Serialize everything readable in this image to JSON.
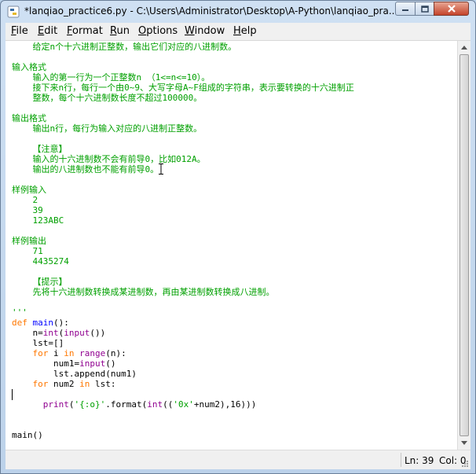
{
  "window": {
    "title": "*lanqiao_practice6.py - C:\\Users\\Administrator\\Desktop\\A-Python\\lanqiao_pra..."
  },
  "menu": [
    "File",
    "Edit",
    "Format",
    "Run",
    "Options",
    "Window",
    "Help"
  ],
  "editor": {
    "lines": [
      "    给定n个十六进制正整数，输出它们对应的八进制数。",
      "",
      "输入格式",
      "    输入的第一行为一个正整数n （1<=n<=10）。",
      "    接下来n行，每行一个由0~9、大写字母A~F组成的字符串，表示要转换的十六进制正",
      "    整数，每个十六进制数长度不超过100000。",
      "",
      "输出格式",
      "    输出n行，每行为输入对应的八进制正整数。",
      "",
      "    【注意】",
      "    输入的十六进制数不会有前导0，比如012A。",
      "    输出的八进制数也不能有前导0。",
      "",
      "样例输入",
      "    2",
      "    39",
      "    123ABC",
      "",
      "样例输出",
      "    71",
      "    4435274",
      "",
      "    【提示】",
      "    先将十六进制数转换成某进制数，再由某进制数转换成八进制。",
      "",
      "'''",
      "def main():",
      "    n=int(input())",
      "    lst=[]",
      "    for i in range(n):",
      "        num1=input()",
      "        lst.append(num1)",
      "    for num2 in lst:",
      "",
      "      print('{:o}'.format(int(('0x'+num2),16)))",
      "",
      "",
      "main()"
    ]
  },
  "status": {
    "line": "Ln: 39",
    "col": "Col: 0"
  },
  "icons": {
    "app": "python-idle-icon",
    "minimize": "minimize-icon",
    "maximize": "maximize-icon",
    "close": "close-icon"
  }
}
